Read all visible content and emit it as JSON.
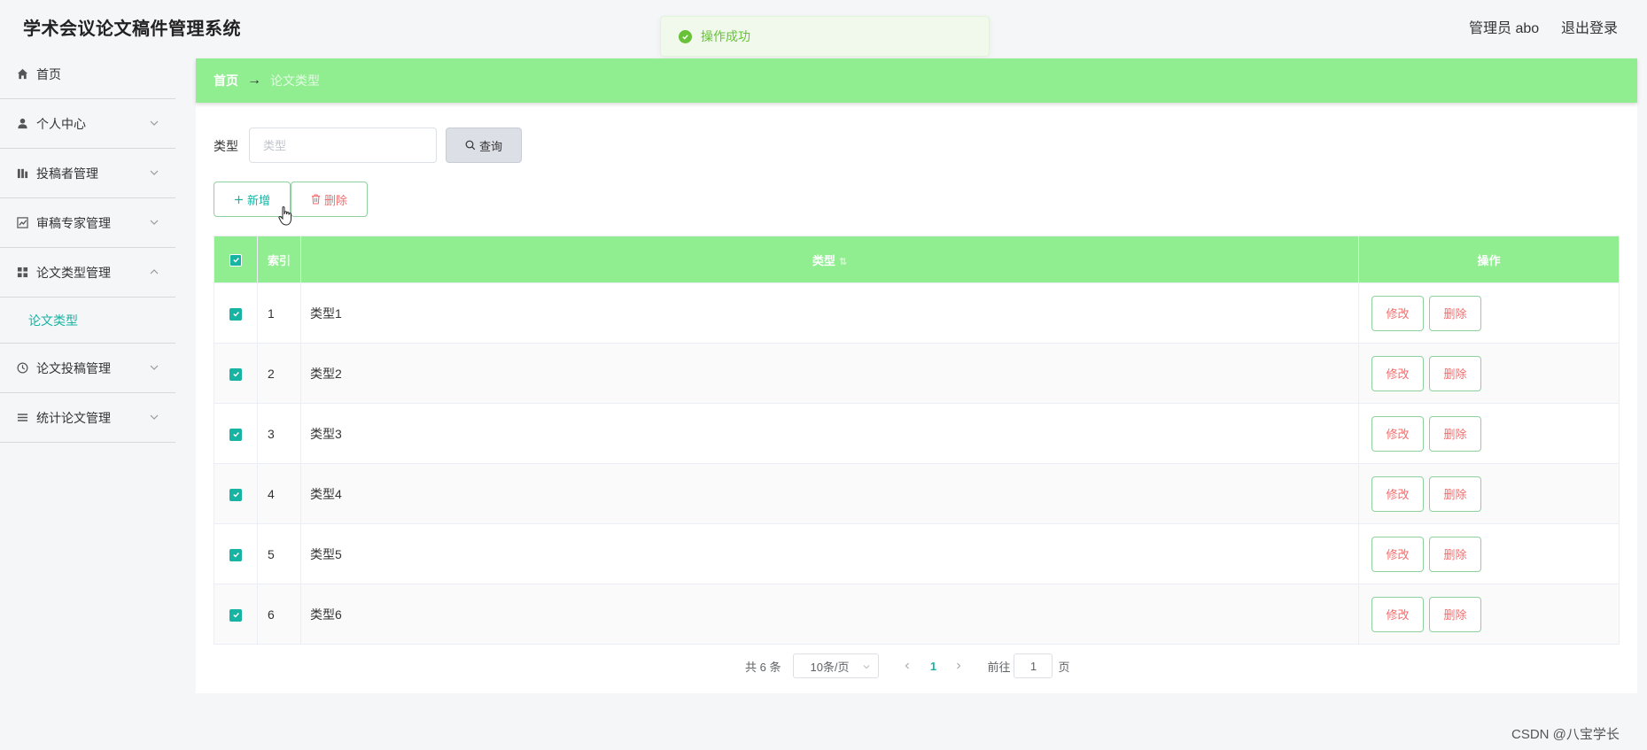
{
  "header": {
    "app_title": "学术会议论文稿件管理系统",
    "user_label": "管理员 abo",
    "logout_label": "退出登录"
  },
  "toast": {
    "message": "操作成功",
    "type": "success"
  },
  "sidebar": {
    "items": [
      {
        "label": "首页",
        "icon": "home-icon"
      },
      {
        "label": "个人中心",
        "icon": "user-icon",
        "expandable": true
      },
      {
        "label": "投稿者管理",
        "icon": "bars-icon",
        "expandable": true
      },
      {
        "label": "审稿专家管理",
        "icon": "chart-icon",
        "expandable": true
      },
      {
        "label": "论文类型管理",
        "icon": "grid-icon",
        "expandable": true,
        "expanded": true,
        "children": [
          {
            "label": "论文类型",
            "active": true
          }
        ]
      },
      {
        "label": "论文投稿管理",
        "icon": "clock-icon",
        "expandable": true
      },
      {
        "label": "统计论文管理",
        "icon": "list-icon",
        "expandable": true
      }
    ]
  },
  "breadcrumb": {
    "home": "首页",
    "separator": "→",
    "current": "论文类型"
  },
  "search": {
    "label": "类型",
    "placeholder": "类型",
    "value": "",
    "button_label": "查询"
  },
  "actions": {
    "add_label": "新增",
    "delete_label": "删除"
  },
  "table": {
    "columns": [
      "索引",
      "类型",
      "操作"
    ],
    "rows": [
      {
        "index": "1",
        "type": "类型1",
        "checked": true
      },
      {
        "index": "2",
        "type": "类型2",
        "checked": true
      },
      {
        "index": "3",
        "type": "类型3",
        "checked": true
      },
      {
        "index": "4",
        "type": "类型4",
        "checked": true
      },
      {
        "index": "5",
        "type": "类型5",
        "checked": true
      },
      {
        "index": "6",
        "type": "类型6",
        "checked": true
      }
    ],
    "row_actions": {
      "edit": "修改",
      "delete": "删除"
    }
  },
  "pagination": {
    "total_text": "共 6 条",
    "page_size": "10条/页",
    "current_page": "1",
    "jump_label": "前往",
    "jump_value": "1",
    "jump_unit": "页"
  },
  "watermark": "CSDN @八宝学长",
  "colors": {
    "accent": "#17b3a3",
    "header_green": "#90ee90",
    "danger": "#f56c6c",
    "success": "#67c23a"
  }
}
